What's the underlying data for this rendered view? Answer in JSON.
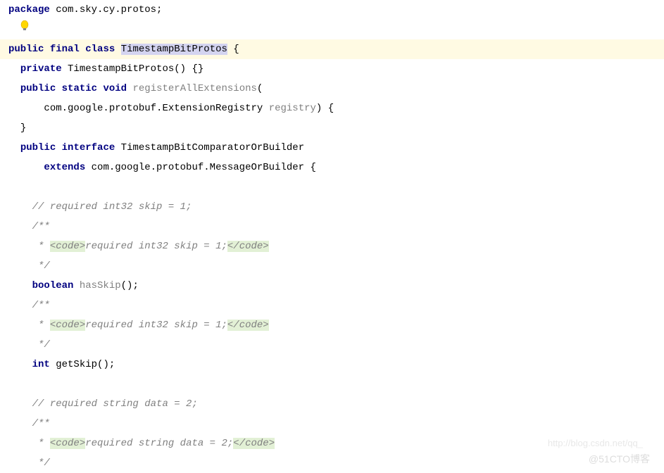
{
  "code": {
    "package_kw": "package",
    "package_name": " com.sky.cy.protos;",
    "public": "public",
    "final": "final",
    "class": "class",
    "class_name": "TimestampBitProtos",
    "brace_open": " {",
    "private": "private",
    "constructor": " TimestampBitProtos() {}",
    "static": "static",
    "void": "void",
    "register_method": "registerAllExtensions",
    "paren_open": "(",
    "param_type": "com.google.protobuf.ExtensionRegistry ",
    "param_name": "registry",
    "paren_close_brace": ") {",
    "close_brace": "}",
    "interface": "interface",
    "interface_name": " TimestampBitComparatorOrBuilder",
    "extends": "extends",
    "extends_type": " com.google.protobuf.MessageOrBuilder {",
    "comment_skip": "// required int32 skip = 1;",
    "doc_open": "/**",
    "doc_star": " * ",
    "code_open": "<code>",
    "doc_skip_text": "required int32 skip = 1;",
    "code_close": "</code>",
    "doc_close": " */",
    "boolean": "boolean",
    "has_skip": "hasSkip",
    "parens_semi": "();",
    "int": "int",
    "get_skip": " getSkip();",
    "comment_data": "// required string data = 2;",
    "doc_data_text": "required string data = 2;",
    "star_slash": "*/"
  },
  "watermark": "@51CTO博客",
  "watermark2": "http://blog.csdn.net/qq_"
}
